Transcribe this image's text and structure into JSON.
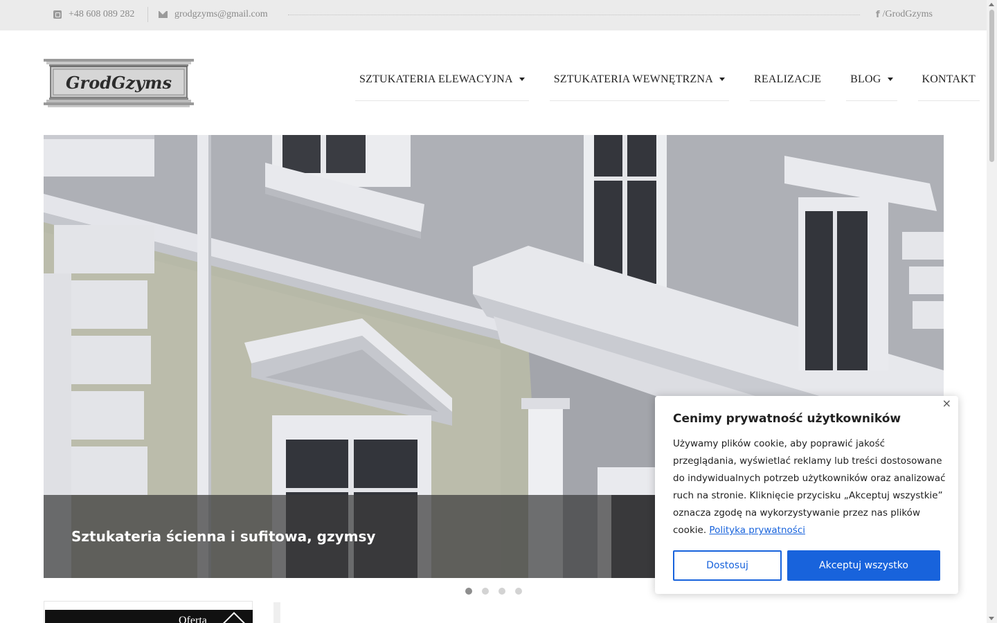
{
  "topbar": {
    "phone_icon": "phone-square-icon",
    "phone": "+48 608 089 282",
    "email_icon": "envelope-icon",
    "email": "grodgzyms@gmail.com",
    "facebook_icon": "facebook-icon",
    "facebook": "/GrodGzyms"
  },
  "logo": {
    "text": "GrodGzyms"
  },
  "nav": {
    "items": [
      {
        "label": "SZTUKATERIA ELEWACYJNA",
        "dropdown": true
      },
      {
        "label": "SZTUKATERIA WEWNĘTRZNA",
        "dropdown": true
      },
      {
        "label": "REALIZACJE",
        "dropdown": false
      },
      {
        "label": "BLOG",
        "dropdown": true
      },
      {
        "label": "KONTAKT",
        "dropdown": false
      }
    ]
  },
  "hero": {
    "caption": "Sztukateria ścienna i sufitowa, gzymsy",
    "slide_count": 4,
    "active_slide": 1
  },
  "sidebar": {
    "card_title": "Oferta"
  },
  "cookie": {
    "title": "Cenimy prywatność użytkowników",
    "text": "Używamy plików cookie, aby poprawić jakość przeglądania, wyświetlać reklamy lub treści dostosowane do indywidualnych potrzeb użytkowników oraz analizować ruch na stronie. Kliknięcie przycisku „Akceptuj wszystkie” oznacza zgodę na wykorzystywanie przez nas plików cookie.",
    "link": "Polityka prywatności",
    "customize_button": "Dostosuj",
    "accept_button": "Akceptuj wszystko",
    "close_label": "×",
    "accent_color": "#1863dc"
  }
}
